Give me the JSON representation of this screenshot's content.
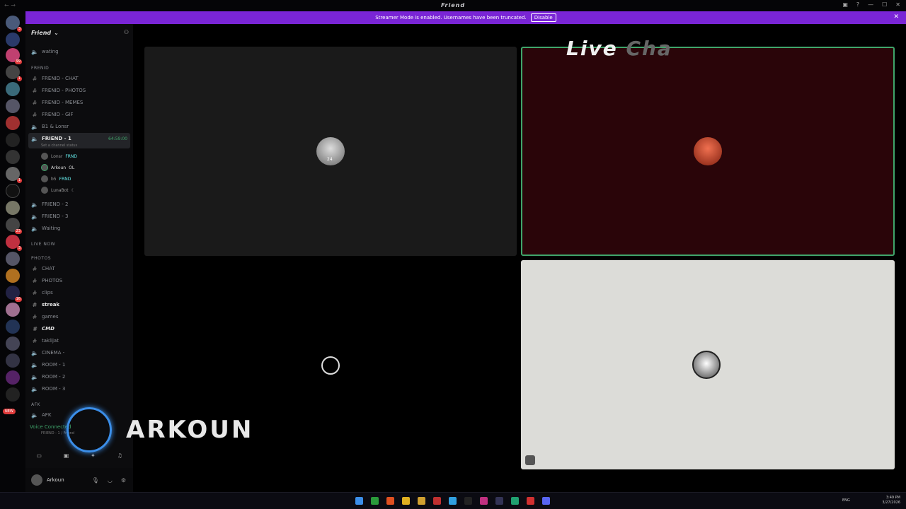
{
  "window": {
    "title": "Friend",
    "controls": [
      "—",
      "☐",
      "✕"
    ]
  },
  "banner": {
    "text": "Streamer Mode is enabled. Usernames have been truncated.",
    "button": "Disable"
  },
  "server": {
    "name": "Friend"
  },
  "channels": {
    "top": [
      {
        "label": "waiting_top",
        "text": "wating"
      }
    ],
    "frend_category": "FRENID",
    "frend_items": [
      "FRENID - CHAT",
      "FRENID - PHOTOS",
      "FRENID - MEMES",
      "FRENID - GIF",
      "B1 & Lonsr"
    ],
    "active": {
      "name": "FRIEND - 1",
      "status": "Set a channel status",
      "timer": "64:59:00"
    },
    "voice_users": [
      {
        "name": "Lonsr",
        "tag": "FRND"
      },
      {
        "name": "Arkoun",
        "tag": "OL"
      },
      {
        "name": "b5",
        "tag": "FRND"
      },
      {
        "name": "LunaBot",
        "tag": ""
      }
    ],
    "after_active": [
      "FRIEND - 2",
      "FRIEND - 3",
      "Waiting"
    ],
    "live_now": "LIVE NOW",
    "photos_category": "PHOTOS",
    "photos_items": [
      "CHAT",
      "PHOTOS",
      "clips",
      "streak",
      "games",
      "CMD",
      "taklijat",
      "CINEMA -",
      "ROOM - 1",
      "ROOM - 2",
      "ROOM - 3"
    ],
    "afk_category": "AFK",
    "afk_item": "AFK"
  },
  "voice_panel": {
    "status": "Voice Connected",
    "channel": "FRIEND - 1 / Friend"
  },
  "user_panel": {
    "name": "Arkoun",
    "status": "dnd"
  },
  "overlay": {
    "live_chat": "Live",
    "live_chat_faded": "Cha",
    "logo_text": "ARKOUN"
  },
  "tiles": {
    "tile1_badge": "24"
  },
  "new_badge": "NEW",
  "clock": {
    "time": "3:49 PM",
    "date": "3/27/2026",
    "lang": "ENG"
  },
  "colors": {
    "banner": "#7a25d6",
    "active_speaker": "#3fa56a",
    "tile_red": "#2a0509",
    "tile_light": "#dcdcd8"
  }
}
